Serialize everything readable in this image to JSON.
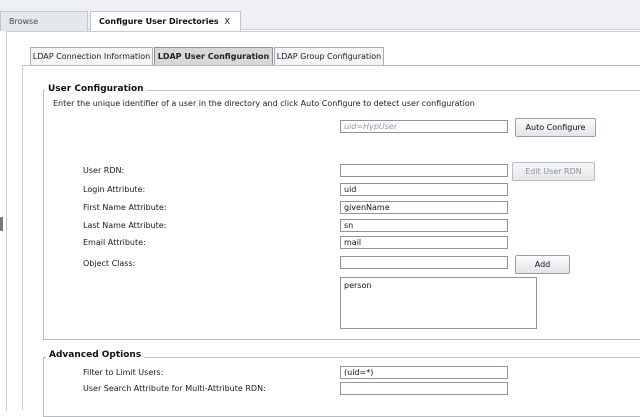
{
  "top_tabs": {
    "browse_label": "Browse",
    "active_label": "Configure User Directories",
    "close_glyph": "X"
  },
  "sub_tabs": {
    "connection_label": "LDAP Connection Information",
    "user_config_label": "LDAP User Configuration",
    "group_config_label": "LDAP Group Configuration"
  },
  "user_configuration": {
    "legend": "User Configuration",
    "instruction": "Enter the unique identifier of a user in the directory and click Auto Configure to detect user configuration",
    "identifier_placeholder": "uid=HypUser",
    "identifier_value": "",
    "auto_configure_label": "Auto Configure",
    "user_rdn_label": "User RDN:",
    "user_rdn_value": "",
    "edit_user_rdn_label": "Edit User RDN",
    "login_attribute_label": "Login Attribute:",
    "login_attribute_value": "uid",
    "first_name_label": "First Name Attribute:",
    "first_name_value": "givenName",
    "last_name_label": "Last Name Attribute:",
    "last_name_value": "sn",
    "email_label": "Email Attribute:",
    "email_value": "mail",
    "object_class_label": "Object Class:",
    "object_class_value": "",
    "add_label": "Add",
    "object_class_list": "person"
  },
  "advanced_options": {
    "legend": "Advanced Options",
    "filter_label": "Filter to Limit Users:",
    "filter_value": "(uid=*)",
    "search_attr_label": "User Search Attribute for Multi-Attribute RDN:",
    "search_attr_value": ""
  }
}
